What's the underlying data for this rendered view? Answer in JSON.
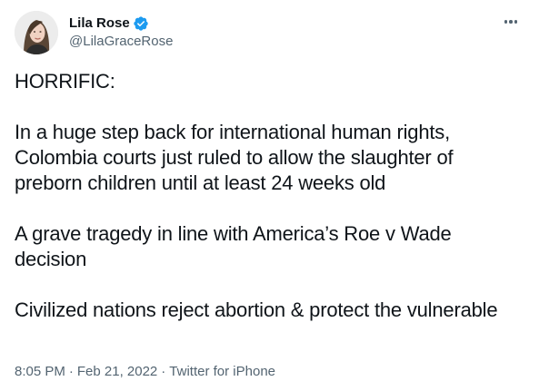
{
  "author": {
    "display_name": "Lila Rose",
    "handle": "@LilaGraceRose",
    "avatar_icon": "avatar-photo",
    "verified_icon": "verified-badge-icon",
    "verified_color": "#1d9bf0"
  },
  "menu": {
    "icon": "more-horizontal-icon"
  },
  "tweet": {
    "paragraphs": [
      "HORRIFIC:",
      "In a huge step back for international human rights, Colombia courts just ruled to allow the slaughter of preborn children until at least 24 weeks old",
      "A grave tragedy in line with America’s Roe v Wade decision",
      "Civilized nations reject abortion & protect the vulnerable"
    ]
  },
  "meta": {
    "time": "8:05 PM",
    "date": "Feb 21, 2022",
    "separator": "·",
    "source": "Twitter for iPhone"
  },
  "colors": {
    "text_primary": "#0f1419",
    "text_secondary": "#536471",
    "background": "#ffffff"
  }
}
